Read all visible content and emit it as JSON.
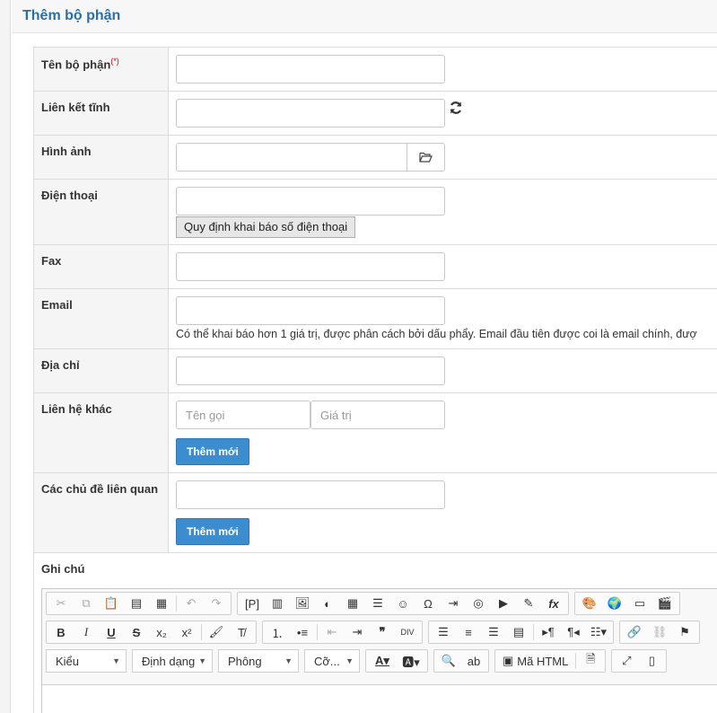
{
  "page": {
    "title": "Thêm bộ phận"
  },
  "form": {
    "name": {
      "label": "Tên bộ phận",
      "required_mark": "(*)",
      "value": ""
    },
    "static_link": {
      "label": "Liên kết tĩnh",
      "value": ""
    },
    "image": {
      "label": "Hình ảnh",
      "value": ""
    },
    "phone": {
      "label": "Điện thoại",
      "value": "",
      "rule_button": "Quy định khai báo số điện thoại"
    },
    "fax": {
      "label": "Fax",
      "value": ""
    },
    "email": {
      "label": "Email",
      "value": "",
      "help": "Có thể khai báo hơn 1 giá trị, được phân cách bởi dấu phẩy. Email đầu tiên được coi là email chính, đượ"
    },
    "address": {
      "label": "Địa chỉ",
      "value": ""
    },
    "other_contact": {
      "label": "Liên hệ khác",
      "name_placeholder": "Tên gọi",
      "value_placeholder": "Giá trị",
      "add_button": "Thêm mới"
    },
    "topics": {
      "label": "Các chủ đề liên quan",
      "value": "",
      "add_button": "Thêm mới"
    },
    "note": {
      "label": "Ghi chú"
    }
  },
  "editor": {
    "combos": {
      "style": "Kiểu",
      "format": "Định dạng",
      "font": "Phông",
      "size": "Cỡ..."
    },
    "buttons": {
      "p_block": "[P]",
      "source": "Mã HTML",
      "bold": "B",
      "italic": "I",
      "underline": "U",
      "strike": "S",
      "omega": "Ω",
      "fx": "fx",
      "quote": "❞",
      "div": "DIV"
    }
  }
}
